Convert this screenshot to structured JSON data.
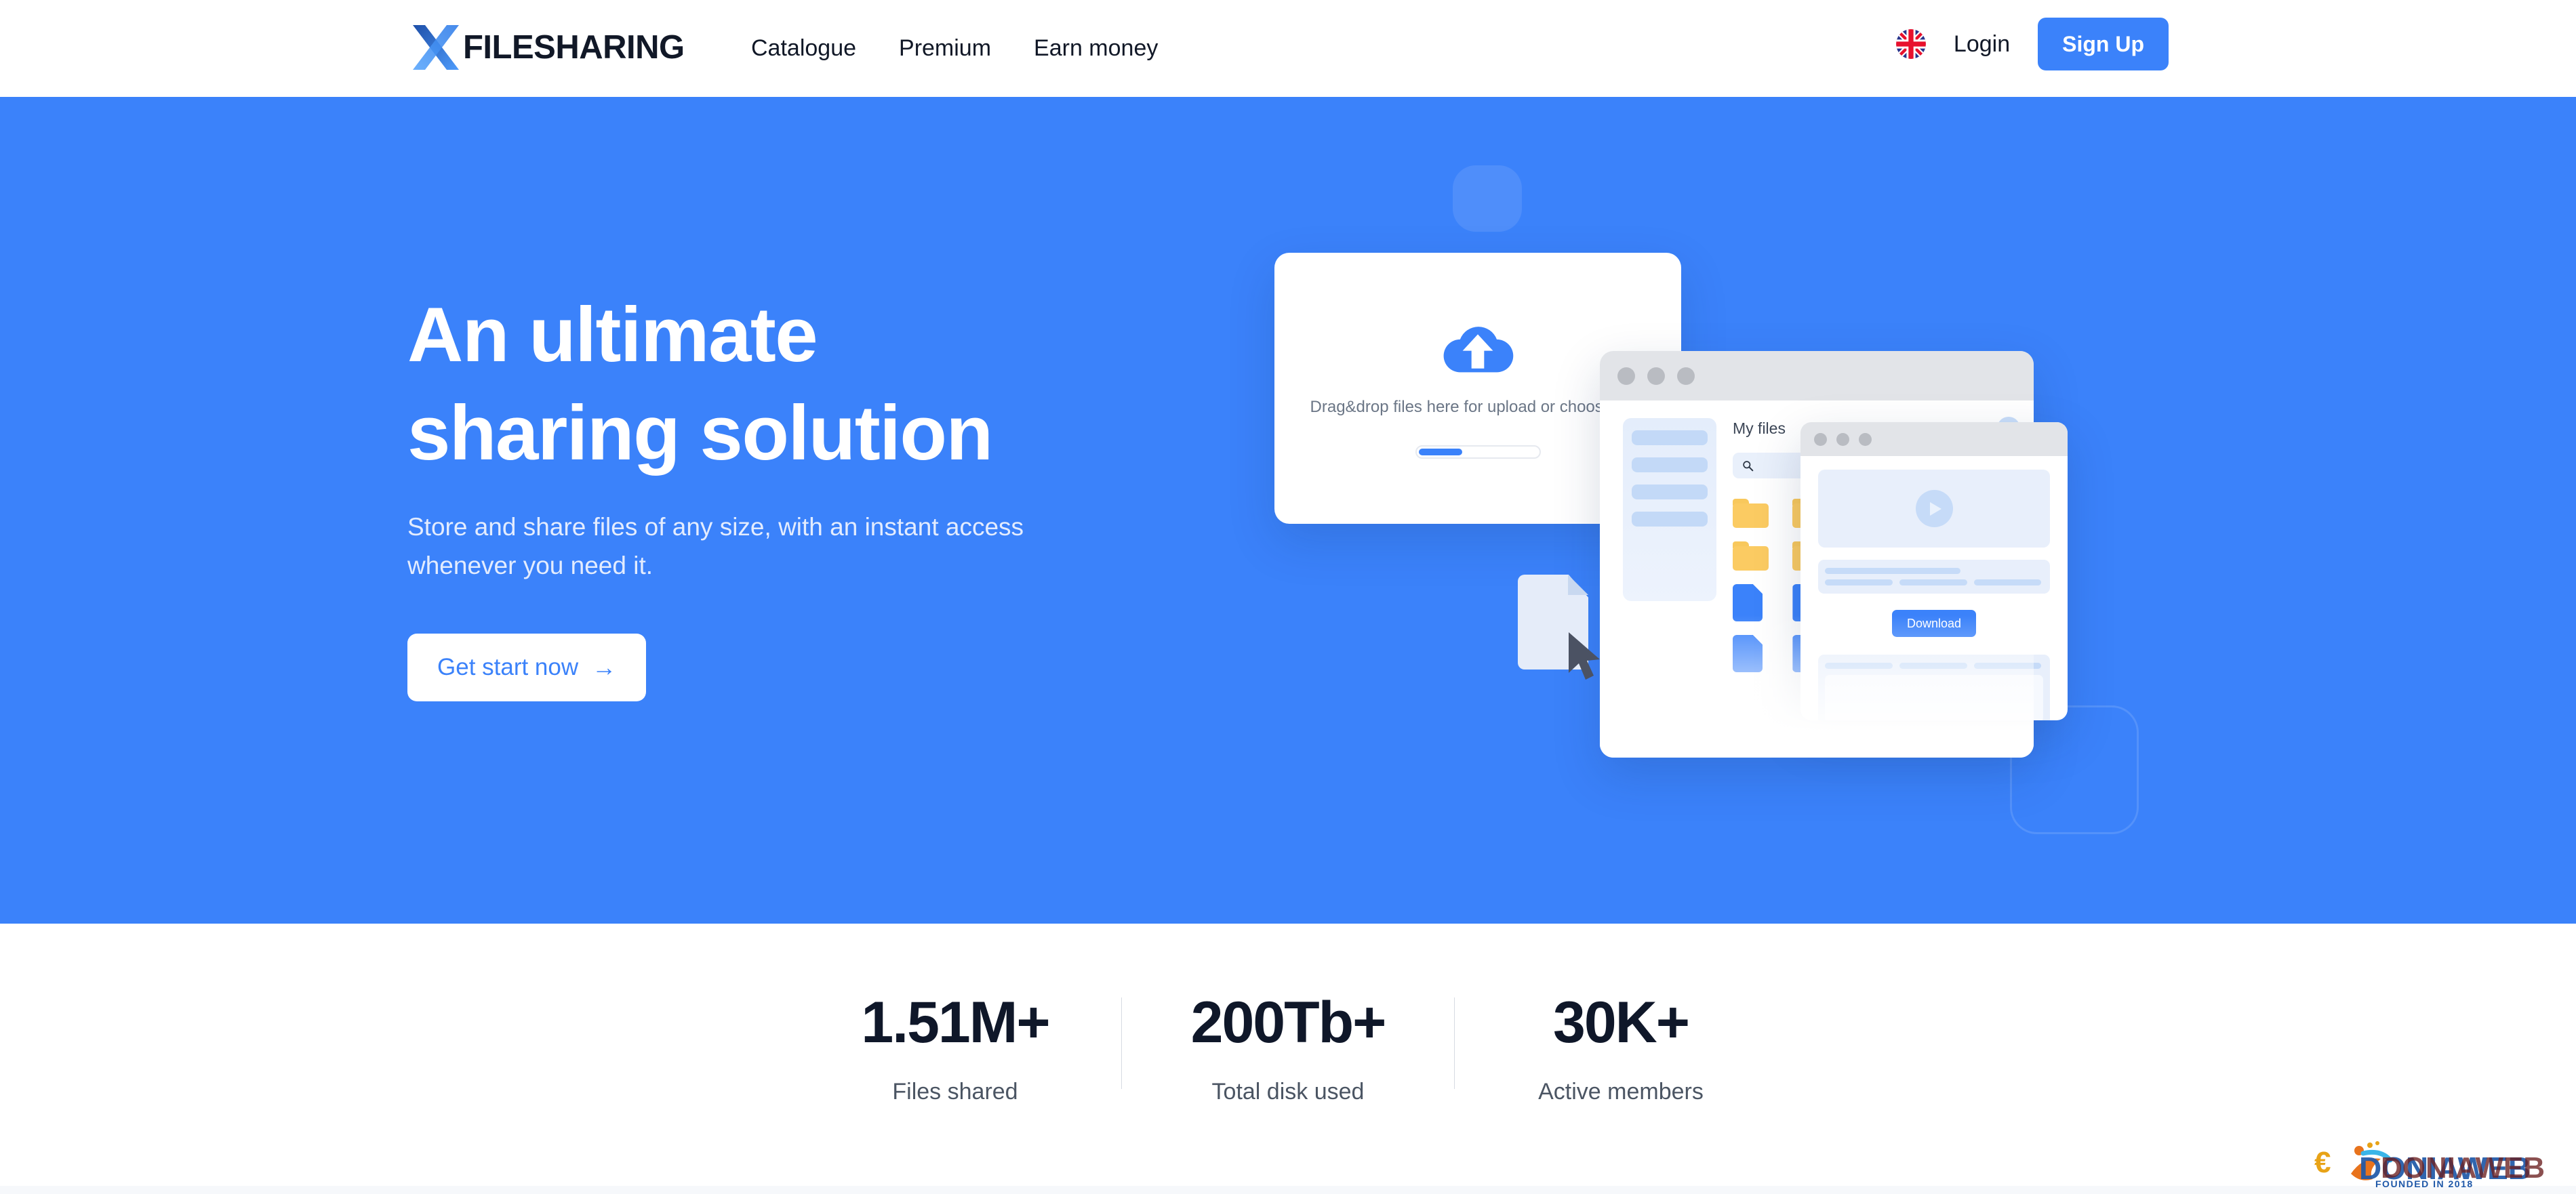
{
  "brand": {
    "logo_icon": "x-logo-icon",
    "name": "FILESHARING",
    "accent_color": "#3B82FA",
    "logo_gradient_start": "#1B3B8C",
    "logo_gradient_end": "#4E9BFB"
  },
  "header": {
    "nav": [
      {
        "label": "Catalogue"
      },
      {
        "label": "Premium"
      },
      {
        "label": "Earn money"
      }
    ],
    "language_icon": "uk-flag-icon",
    "login_label": "Login",
    "signup_label": "Sign Up"
  },
  "hero": {
    "title_line1": "An ultimate",
    "title_line2": "sharing solution",
    "subtitle": "Store and share files of any size, with an instant access whenever you need it.",
    "cta_label": "Get start now",
    "cta_arrow": "→",
    "background_color": "#3B82FA"
  },
  "illustration": {
    "files_window": {
      "title": "My files",
      "search_placeholder": "",
      "search_icon": "search-icon",
      "avatar_icon": "avatar-icon",
      "sidebar_rows": 4,
      "folders_row1": 5,
      "folders_row2": 3,
      "files_row1": 3,
      "files_row2": 3
    },
    "upload_card": {
      "icon": "cloud-upload-icon",
      "text": "Drag&drop files here for upload or choose files",
      "progress_percent": 37
    },
    "download_window": {
      "play_icon": "play-icon",
      "download_label": "Download"
    },
    "dragged_file_icon": "file-document-icon",
    "cursor_icon": "mouse-pointer-icon"
  },
  "stats": [
    {
      "value": "1.51M+",
      "label": "Files shared"
    },
    {
      "value": "200Tb+",
      "label": "Total disk used"
    },
    {
      "value": "30K+",
      "label": "Active members"
    }
  ],
  "watermark": {
    "text": "DONIAWEB",
    "tagline": "FOUNDED IN 2018"
  }
}
